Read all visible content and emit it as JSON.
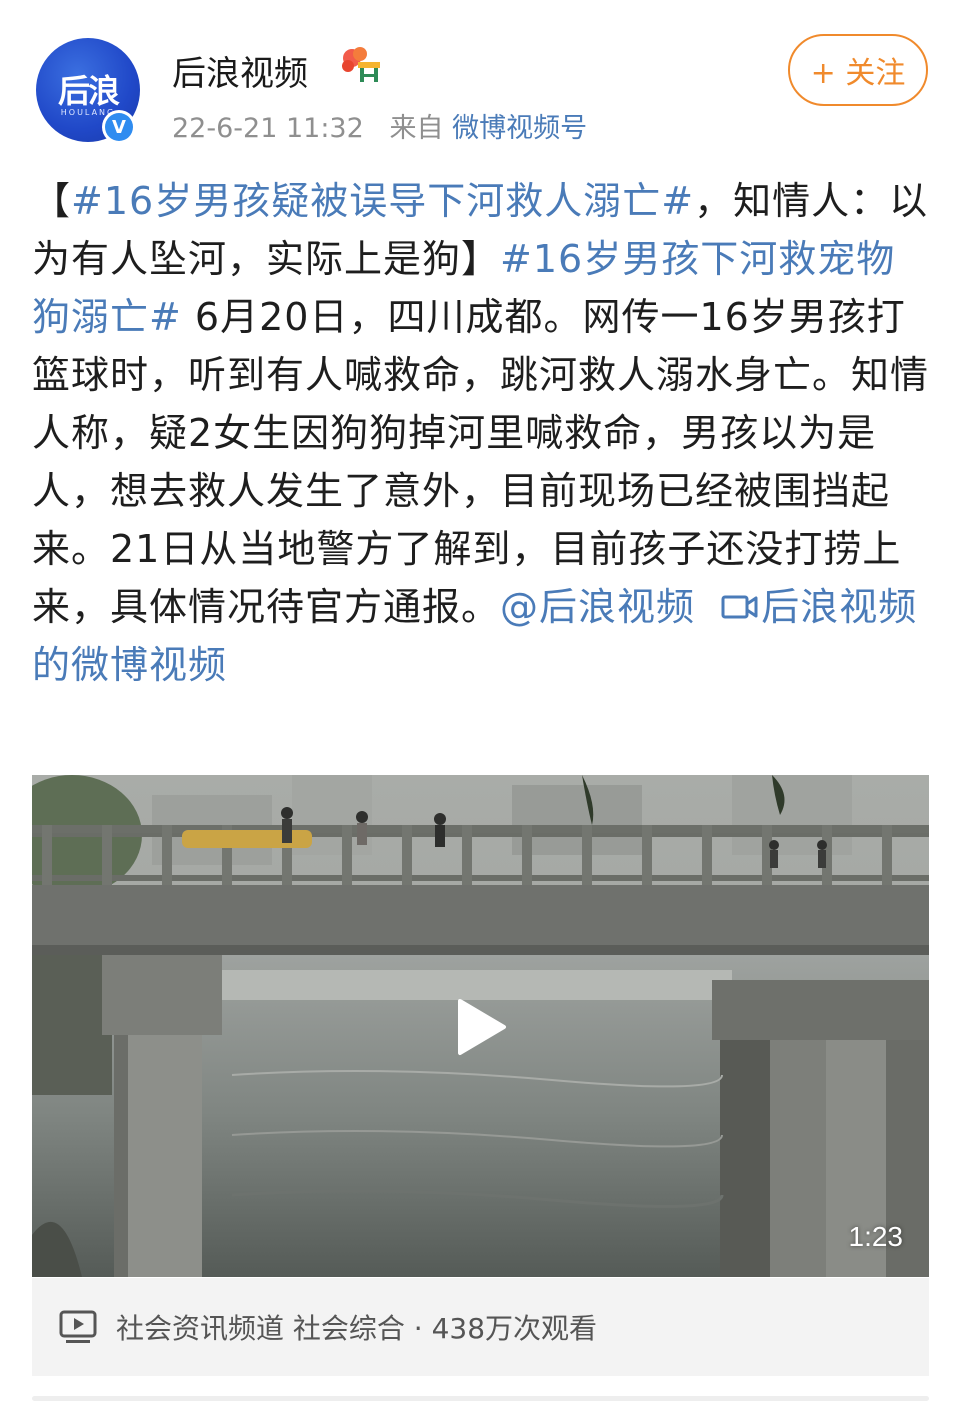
{
  "post": {
    "author": {
      "name": "后浪视频",
      "avatar_text": "后浪",
      "avatar_sub": "HOULANG",
      "verified_mark": "V",
      "badge_icon": "flower-stand-icon"
    },
    "timestamp": "22-6-21 11:32",
    "source_prefix": "来自",
    "source": "微博视频号",
    "follow_label": "+ 关注"
  },
  "content": {
    "open_bracket": "【",
    "topic1": "#16岁男孩疑被误导下河救人溺亡#",
    "text1": "，知情人：以为有人坠河，实际上是狗】",
    "topic2": "#16岁男孩下河救宠物狗溺亡#",
    "text2": " 6月20日，四川成都。网传一16岁男孩打篮球时，听到有人喊救命，跳河救人溺水身亡。知情人称，疑2女生因狗狗掉河里喊救命，男孩以为是人，想去救人发生了意外，目前现场已经被围挡起来。21日从当地警方了解到，目前孩子还没打捞上来，具体情况待官方通报。",
    "mention": "@后浪视频",
    "video_link": "后浪视频的微博视频"
  },
  "video": {
    "duration": "1:23",
    "play_icon": "play-icon"
  },
  "channel": {
    "icon": "video-channel-icon",
    "text": "社会资讯频道 社会综合 · 438万次观看"
  },
  "colors": {
    "link": "#4a7bb8",
    "follow": "#f08a2c",
    "verified": "#2f8cf0",
    "avatar": "#2048c8"
  }
}
